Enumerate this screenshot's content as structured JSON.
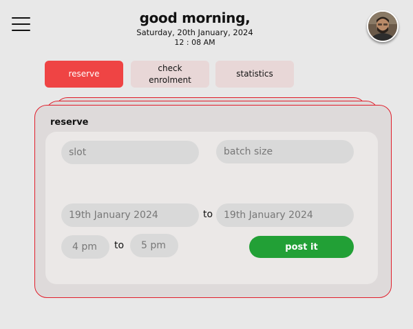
{
  "header": {
    "greeting": "good morning,",
    "date": "Saturday, 20th January, 2024",
    "time": "12 : 08 AM"
  },
  "tabs": [
    {
      "label": "reserve",
      "active": true
    },
    {
      "label": "check enrolment",
      "active": false
    },
    {
      "label": "statistics",
      "active": false
    }
  ],
  "reserve_card": {
    "title": "reserve",
    "slot_placeholder": "slot",
    "batch_size_placeholder": "batch size",
    "date_from": "19th January 2024",
    "date_to": "19th January 2024",
    "time_from": "4 pm",
    "time_to": "5 pm",
    "to_label": "to",
    "submit_label": "post it"
  },
  "colors": {
    "accent_red": "#ef4444",
    "card_border": "#e11d2a",
    "submit_green": "#22a036",
    "inactive_tab": "#e8d7d7"
  },
  "icons": {
    "menu": "hamburger-menu-icon",
    "profile": "user-avatar"
  }
}
